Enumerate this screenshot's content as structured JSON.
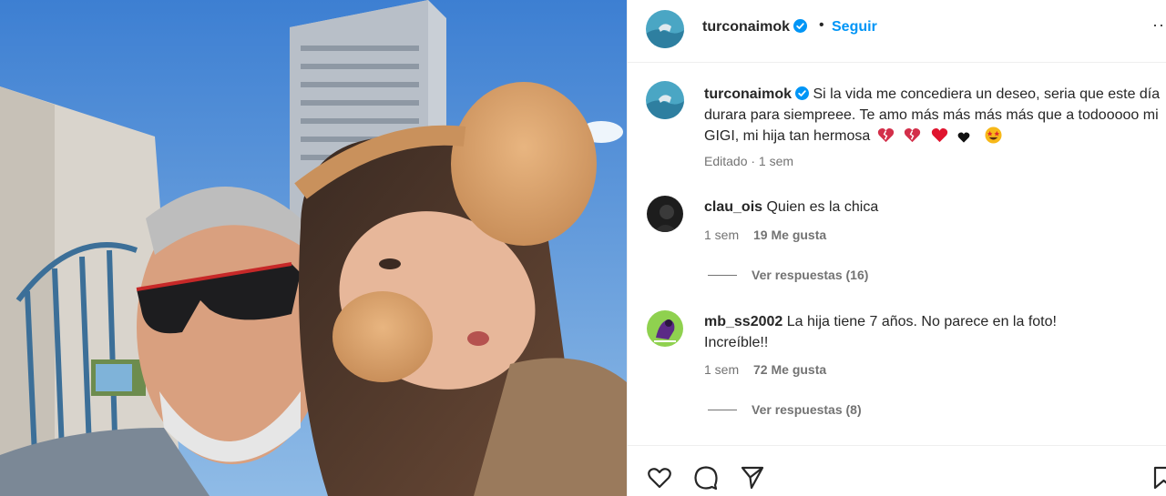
{
  "post": {
    "username": "turconaimok",
    "separator": "•",
    "follow_label": "Seguir",
    "more_label": "··",
    "caption": "Si la vida me concediera un deseo, seria que este día durara para siempreee. Te amo más más más más que a todooooo mi GIGI, mi hija tan hermosa",
    "caption_meta": "Editado · 1 sem",
    "emojis": [
      "heart-broken-icon",
      "heart-broken-icon",
      "heart-red-icon",
      "heart-black-icon",
      "star-eyes-face-icon"
    ]
  },
  "comments": [
    {
      "username": "clau_ois",
      "text": "Quien es la chica",
      "time": "1 sem",
      "likes": "19 Me gusta",
      "replies": "Ver respuestas (16)"
    },
    {
      "username": "mb_ss2002",
      "text": "La hija tiene 7 años. No parece en la foto! Increíble!!",
      "time": "1 sem",
      "likes": "72 Me gusta",
      "replies": "Ver respuestas (8)"
    }
  ],
  "actions": [
    "heart-icon",
    "comment-icon",
    "share-icon",
    "save-icon"
  ],
  "colors": {
    "accent": "#0095f6",
    "text": "#262626",
    "muted": "#737373",
    "verified": "#0095f6"
  }
}
